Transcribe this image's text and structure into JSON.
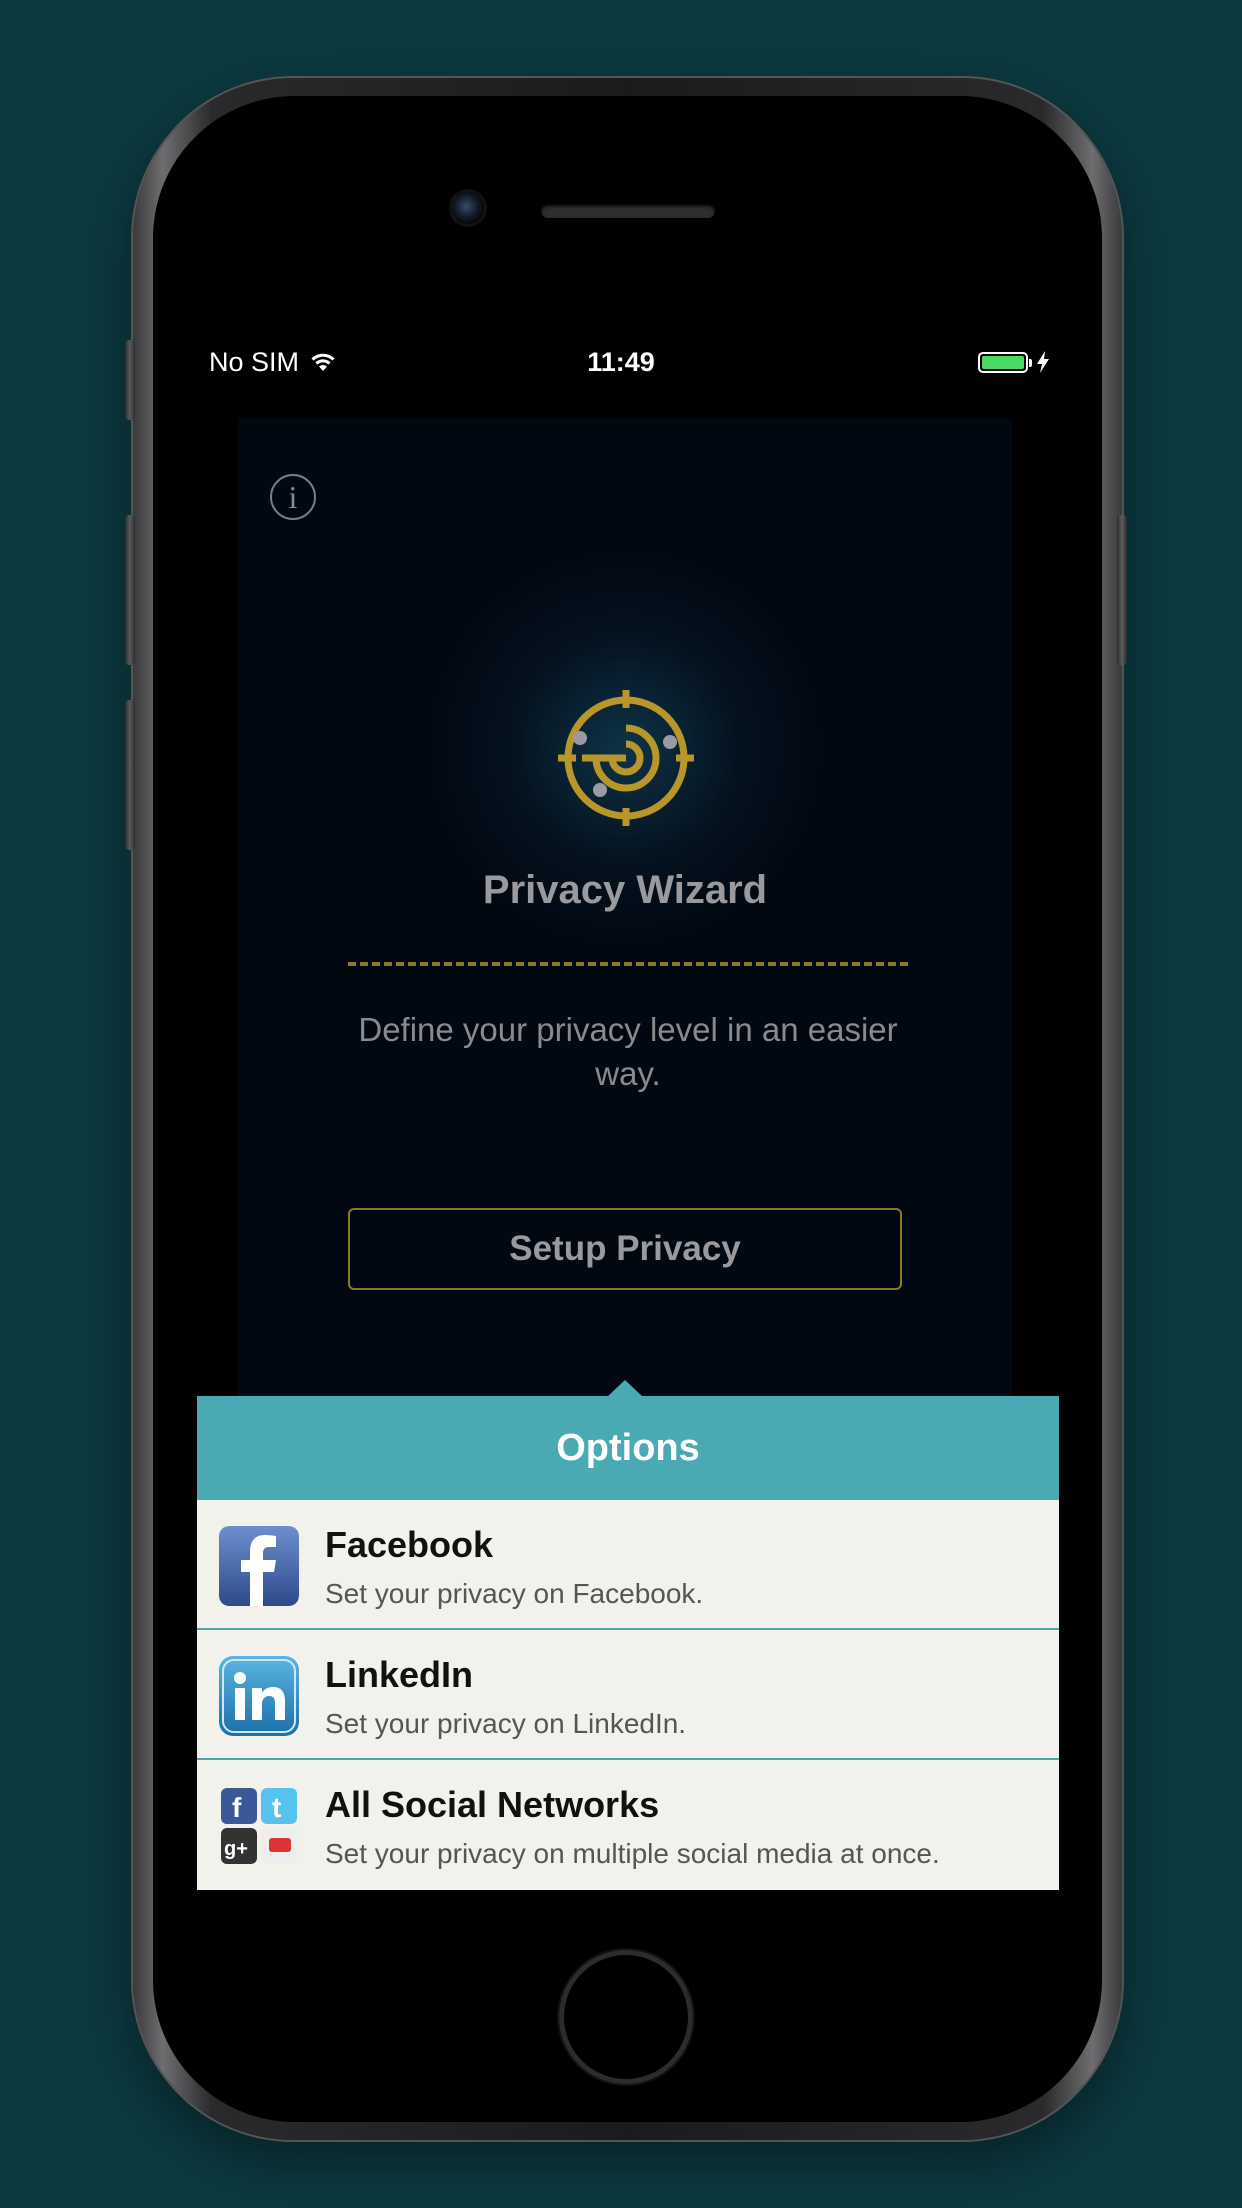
{
  "status_bar": {
    "carrier": "No SIM",
    "time": "11:49",
    "wifi_icon": "wifi-icon",
    "battery_icon": "battery-charging-icon",
    "battery_color": "#4cd964"
  },
  "app": {
    "title": "Privacy Wizard",
    "subtitle": "Define your privacy level in an easier way.",
    "setup_button": "Setup Privacy",
    "info_icon": "info-icon",
    "logo_icon": "target-logo-icon",
    "accent_color": "#b8962a"
  },
  "popover": {
    "title": "Options",
    "header_color": "#49aab3",
    "items": [
      {
        "title": "Facebook",
        "description": "Set your privacy on Facebook.",
        "icon": "facebook-icon"
      },
      {
        "title": "LinkedIn",
        "description": "Set your privacy on LinkedIn.",
        "icon": "linkedin-icon"
      },
      {
        "title": "All Social Networks",
        "description": "Set your privacy on multiple social media at once.",
        "icon": "social-networks-icon"
      }
    ]
  }
}
